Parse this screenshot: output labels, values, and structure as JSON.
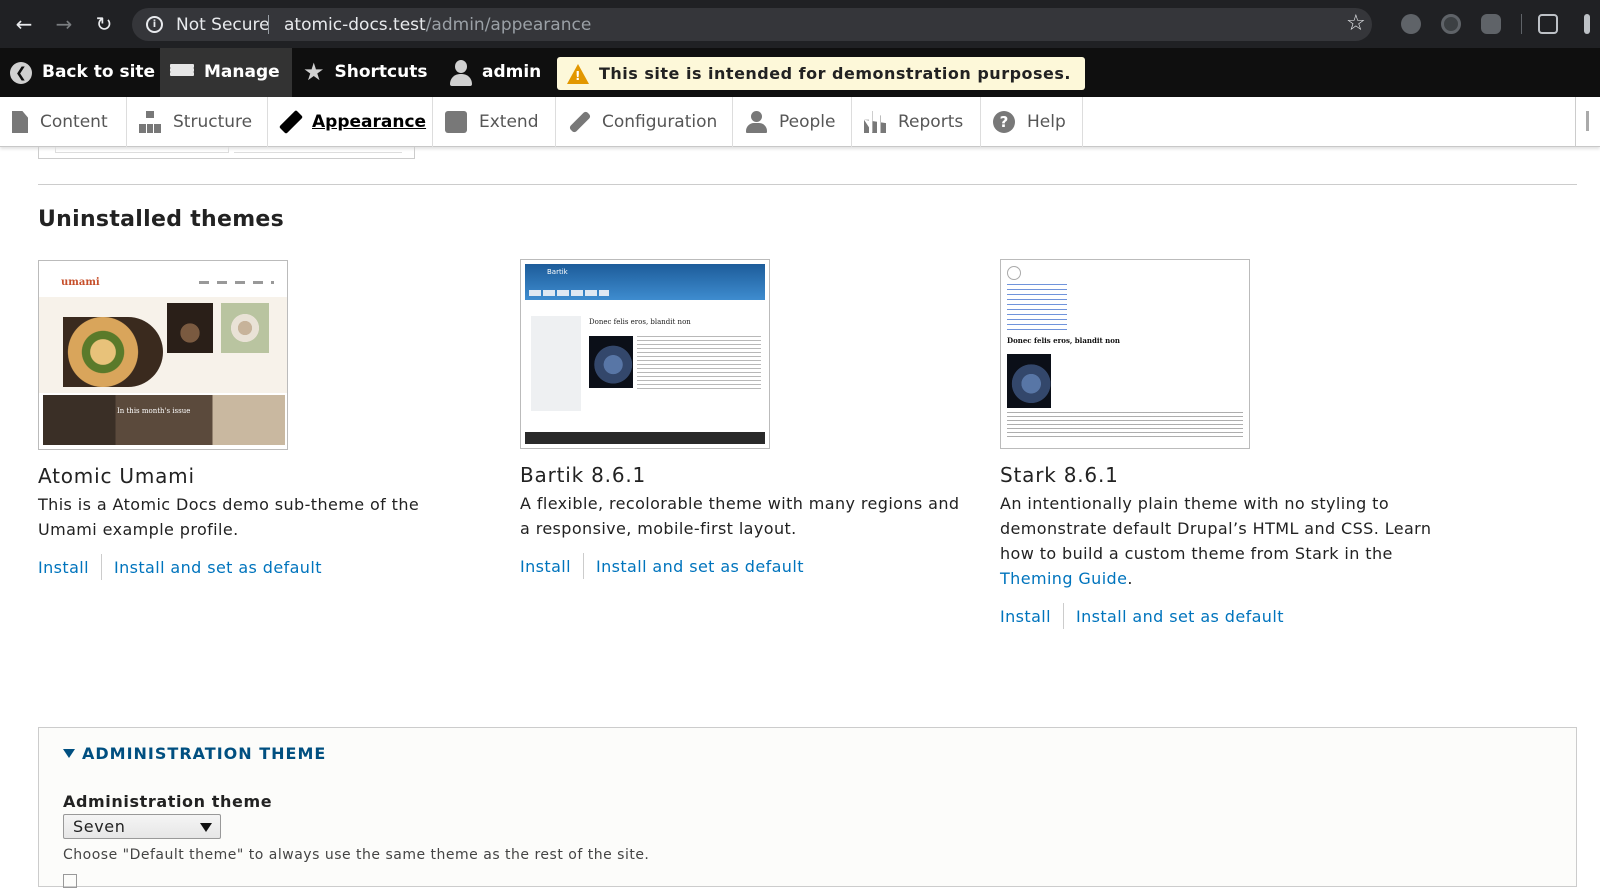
{
  "browser": {
    "security_label": "Not Secure",
    "url_host": "atomic-docs.test",
    "url_path": "/admin/appearance"
  },
  "toolbar": {
    "back": "Back to site",
    "manage": "Manage",
    "shortcuts": "Shortcuts",
    "user": "admin",
    "banner": "This site is intended for demonstration purposes."
  },
  "tray": {
    "items": [
      {
        "label": "Content",
        "icon": "file-icon"
      },
      {
        "label": "Structure",
        "icon": "sitemap-icon"
      },
      {
        "label": "Appearance",
        "icon": "paintbrush-icon"
      },
      {
        "label": "Extend",
        "icon": "puzzle-icon"
      },
      {
        "label": "Configuration",
        "icon": "wrench-icon"
      },
      {
        "label": "People",
        "icon": "people-icon"
      },
      {
        "label": "Reports",
        "icon": "bar-chart-icon"
      },
      {
        "label": "Help",
        "icon": "help-icon"
      }
    ],
    "active": "Appearance"
  },
  "section_title": "Uninstalled themes",
  "themes": [
    {
      "name": "Atomic Umami",
      "description": "This is a Atomic Docs demo sub-theme of the Umami example profile.",
      "install": "Install",
      "install_default": "Install and set as default",
      "screenshot": {
        "logo": "umami",
        "banner": "In this month's issue"
      }
    },
    {
      "name": "Bartik 8.6.1",
      "description": "A flexible, recolorable theme with many regions and a responsive, mobile-first layout.",
      "install": "Install",
      "install_default": "Install and set as default",
      "screenshot": {
        "site_name": "Bartik",
        "heading": "Donec felis eros, blandit non"
      }
    },
    {
      "name": "Stark 8.6.1",
      "description_before": "An intentionally plain theme with no styling to demonstrate default Drupal’s HTML and CSS. Learn how to build a custom theme from Stark in the ",
      "description_link": "Theming Guide",
      "description_after": ".",
      "install": "Install",
      "install_default": "Install and set as default",
      "screenshot": {
        "heading": "Donec felis eros, blandit non"
      }
    }
  ],
  "admin_theme": {
    "summary": "ADMINISTRATION THEME",
    "label": "Administration theme",
    "selected": "Seven",
    "help": "Choose \"Default theme\" to always use the same theme as the rest of the site."
  },
  "colors": {
    "link": "#0074bd",
    "toolbar_bg": "#0f0f0f",
    "banner_bg": "#fdf8d9",
    "details_summary": "#004f80"
  }
}
